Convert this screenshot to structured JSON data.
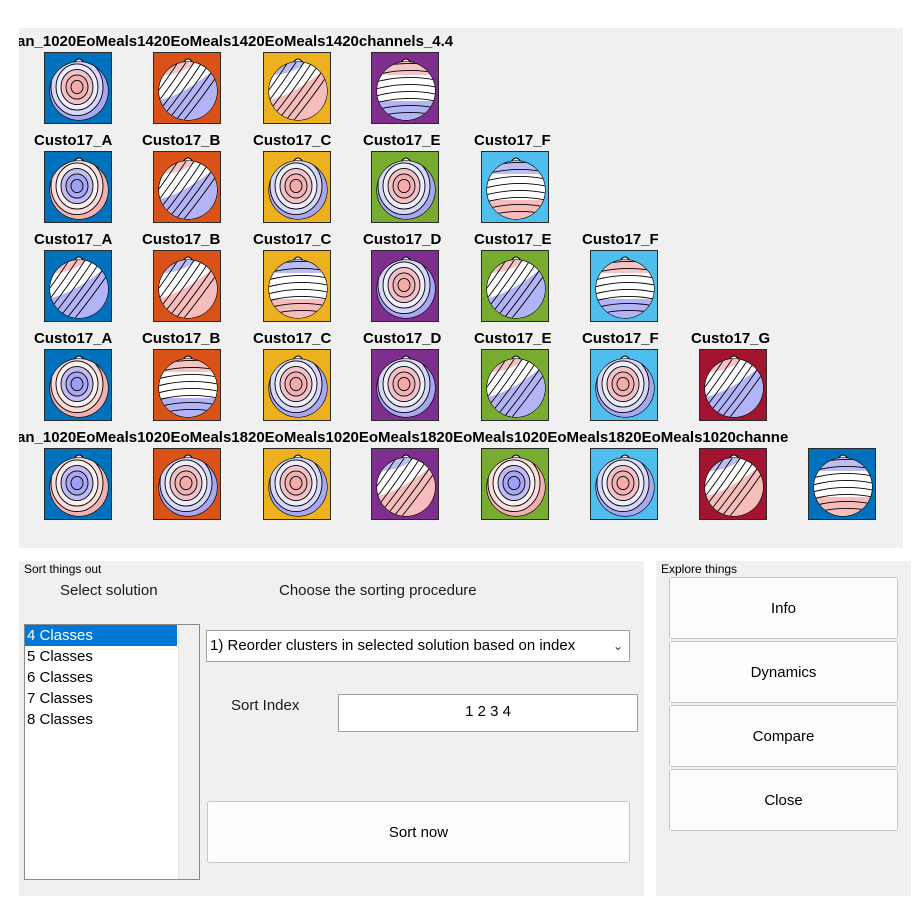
{
  "maps": {
    "rows": [
      {
        "title": "an_1020EoMeals1420EoMeals1420EoMeals1420channels_4.4",
        "tiles": [
          {
            "color": "#0072bd",
            "pattern": "rings-red"
          },
          {
            "color": "#d95319",
            "pattern": "diag-blue"
          },
          {
            "color": "#edb120",
            "pattern": "diag-red"
          },
          {
            "color": "#7e2f8e",
            "pattern": "horiz-blue"
          }
        ]
      },
      {
        "titles": [
          "Custo17_A",
          "Custo17_B",
          "Custo17_C",
          "Custo17_E",
          "Custo17_F"
        ],
        "tiles": [
          {
            "color": "#0072bd",
            "pattern": "rings-blue"
          },
          {
            "color": "#d95319",
            "pattern": "diag-blue"
          },
          {
            "color": "#edb120",
            "pattern": "rings-red"
          },
          {
            "color": "#77ac30",
            "pattern": "rings-red"
          },
          {
            "color": "#4dbeee",
            "pattern": "horiz-red"
          }
        ]
      },
      {
        "titles": [
          "Custo17_A",
          "Custo17_B",
          "Custo17_C",
          "Custo17_D",
          "Custo17_E",
          "Custo17_F"
        ],
        "tiles": [
          {
            "color": "#0072bd",
            "pattern": "diag-blue"
          },
          {
            "color": "#d95319",
            "pattern": "diag-red"
          },
          {
            "color": "#edb120",
            "pattern": "horiz-red"
          },
          {
            "color": "#7e2f8e",
            "pattern": "rings-red"
          },
          {
            "color": "#77ac30",
            "pattern": "diag-blue"
          },
          {
            "color": "#4dbeee",
            "pattern": "horiz-blue"
          }
        ]
      },
      {
        "titles": [
          "Custo17_A",
          "Custo17_B",
          "Custo17_C",
          "Custo17_D",
          "Custo17_E",
          "Custo17_F",
          "Custo17_G"
        ],
        "tiles": [
          {
            "color": "#0072bd",
            "pattern": "rings-blue"
          },
          {
            "color": "#d95319",
            "pattern": "horiz-blue"
          },
          {
            "color": "#edb120",
            "pattern": "rings-red"
          },
          {
            "color": "#7e2f8e",
            "pattern": "rings-red"
          },
          {
            "color": "#77ac30",
            "pattern": "diag-blue"
          },
          {
            "color": "#4dbeee",
            "pattern": "rings-red"
          },
          {
            "color": "#a2142f",
            "pattern": "diag-blue"
          }
        ]
      },
      {
        "title": "an_1020EoMeals1020EoMeals1820EoMeals1020EoMeals1820EoMeals1020EoMeals1820EoMeals1020channe",
        "tiles": [
          {
            "color": "#0072bd",
            "pattern": "rings-blue"
          },
          {
            "color": "#d95319",
            "pattern": "rings-red"
          },
          {
            "color": "#edb120",
            "pattern": "rings-red"
          },
          {
            "color": "#7e2f8e",
            "pattern": "diag-red"
          },
          {
            "color": "#77ac30",
            "pattern": "rings-blue"
          },
          {
            "color": "#4dbeee",
            "pattern": "rings-red"
          },
          {
            "color": "#a2142f",
            "pattern": "diag-red"
          },
          {
            "color": "#0072bd",
            "pattern": "horiz-red"
          }
        ]
      }
    ]
  },
  "sort_panel": {
    "title": "Sort things out",
    "select_label": "Select solution",
    "procedure_label": "Choose the sorting procedure",
    "solutions": [
      "4 Classes",
      "5 Classes",
      "6 Classes",
      "7 Classes",
      "8 Classes"
    ],
    "selected_index": 0,
    "procedure_value": "1) Reorder clusters in selected solution based on index",
    "sort_index_label": "Sort Index",
    "sort_index_value": "1 2 3 4",
    "sort_button": "Sort now"
  },
  "explore_panel": {
    "title": "Explore things",
    "buttons": [
      "Info",
      "Dynamics",
      "Compare",
      "Close"
    ]
  },
  "icons": {
    "dropdown": "chevron-down-icon"
  }
}
